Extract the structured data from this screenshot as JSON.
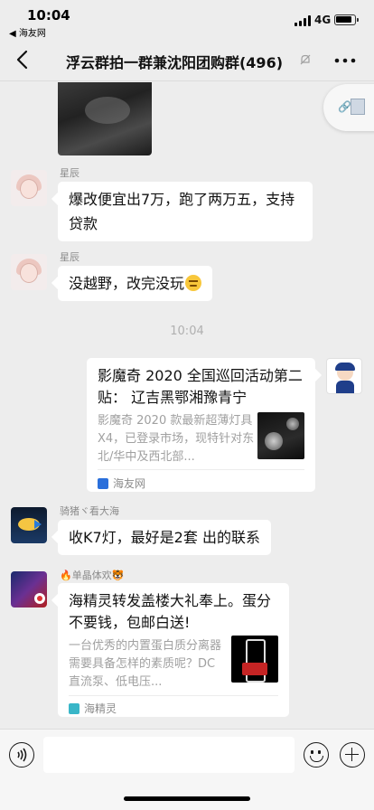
{
  "status_bar": {
    "time": "10:04",
    "back_to_app": "◀ 海友网",
    "network": "4G"
  },
  "nav": {
    "title": "浮云群拍一群兼沈阳团购群(496)"
  },
  "messages": [
    {
      "sender": "星辰",
      "text": "爆改便宜出7万，跑了两万五，支持贷款"
    },
    {
      "sender": "星辰",
      "text": "没越野，改完没玩"
    }
  ],
  "time_divider": "10:04",
  "self_card": {
    "title": "影魔奇 2020 全国巡回活动第二贴： 辽吉黑鄂湘豫青宁",
    "description": "影魔奇 2020 款最新超薄灯具 X4，已登录市场，现特针对东北/华中及西北部...",
    "source": "海友网",
    "source_color": "#2a6fdb"
  },
  "message_3": {
    "sender": "骑猪ヾ看大海",
    "text": "收K7灯，最好是2套 出的联系"
  },
  "card_2": {
    "sender": "🔥单晶体欢🐯",
    "title": "海精灵转发盖楼大礼奉上。蛋分不要钱，包邮白送!",
    "description": "一台优秀的内置蛋白质分离器需要具备怎样的素质呢？DC 直流泵、低电压...",
    "source": "海精灵",
    "source_color": "#39b6c8"
  },
  "input_bar": {
    "placeholder": ""
  }
}
